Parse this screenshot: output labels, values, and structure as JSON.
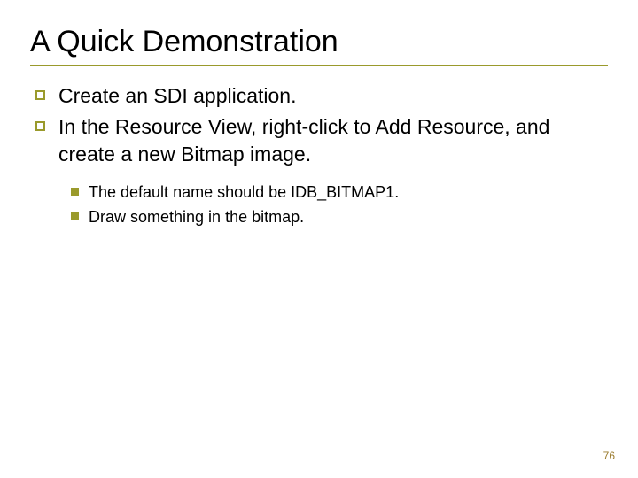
{
  "title": "A Quick Demonstration",
  "bullets": {
    "b1": "Create an SDI application.",
    "b2": "In the Resource View, right-click to Add Resource, and create a new Bitmap image.",
    "sub1": "The default name should be IDB_BITMAP1.",
    "sub2": "Draw something in the bitmap."
  },
  "page_number": "76"
}
